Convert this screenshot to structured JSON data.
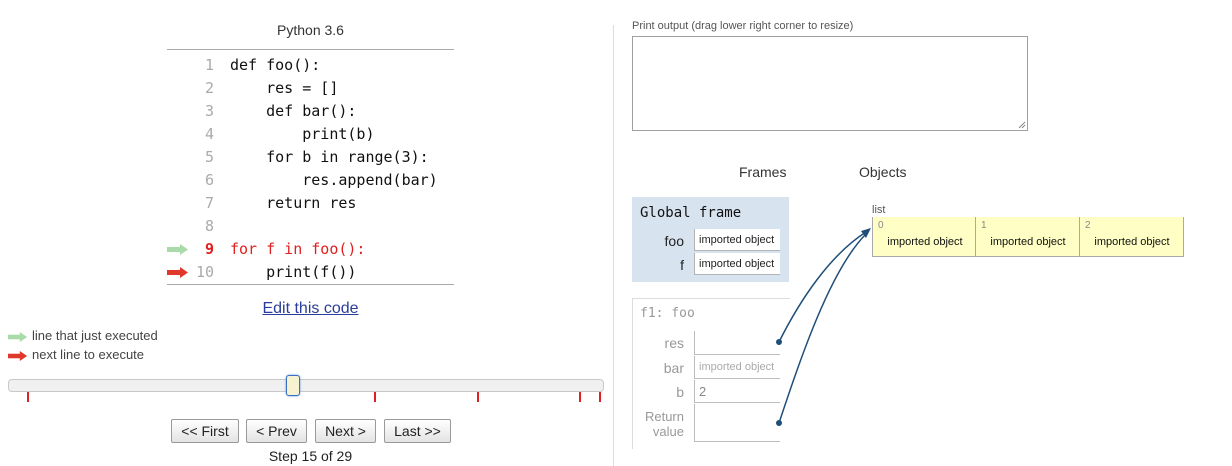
{
  "language": "Python 3.6",
  "code_lines": [
    {
      "num": "1",
      "text": "def foo():",
      "state": ""
    },
    {
      "num": "2",
      "text": "    res = []",
      "state": ""
    },
    {
      "num": "3",
      "text": "    def bar():",
      "state": ""
    },
    {
      "num": "4",
      "text": "        print(b)",
      "state": ""
    },
    {
      "num": "5",
      "text": "    for b in range(3):",
      "state": ""
    },
    {
      "num": "6",
      "text": "        res.append(bar)",
      "state": ""
    },
    {
      "num": "7",
      "text": "    return res",
      "state": ""
    },
    {
      "num": "8",
      "text": "",
      "state": ""
    },
    {
      "num": "9",
      "text": "for f in foo():",
      "state": "just_executed"
    },
    {
      "num": "10",
      "text": "    print(f())",
      "state": "next"
    }
  ],
  "edit_link": "Edit this code",
  "legend": {
    "just_executed": "line that just executed",
    "next": "next line to execute",
    "just_executed_color": "#a8dba8",
    "next_color": "#e0382b"
  },
  "slider": {
    "step": 15,
    "total": 29
  },
  "buttons": {
    "first": "<< First",
    "prev": "< Prev",
    "next": "Next >",
    "last": "Last >>"
  },
  "step_text": "Step 15 of 29",
  "print_output_label": "Print output (drag lower right corner to resize)",
  "print_output": "",
  "frames_heading": "Frames",
  "objects_heading": "Objects",
  "global_frame": {
    "title": "Global frame",
    "vars": [
      {
        "name": "foo",
        "value": "imported object"
      },
      {
        "name": "f",
        "value": "imported object"
      }
    ]
  },
  "f1_frame": {
    "title": "f1: foo",
    "vars": [
      {
        "name": "res",
        "value": ""
      },
      {
        "name": "bar",
        "value": "imported object"
      },
      {
        "name": "b",
        "value": "2"
      }
    ],
    "return_label_1": "Return",
    "return_label_2": "value",
    "return_value": ""
  },
  "list_object": {
    "label": "list",
    "items": [
      {
        "index": "0",
        "value": "imported object"
      },
      {
        "index": "1",
        "value": "imported object"
      },
      {
        "index": "2",
        "value": "imported object"
      }
    ]
  },
  "colors": {
    "pointer": "#1f4e79",
    "frame_bg": "#d8e3f0",
    "object_bg": "#ffffc5",
    "current_line": "#e02020"
  }
}
